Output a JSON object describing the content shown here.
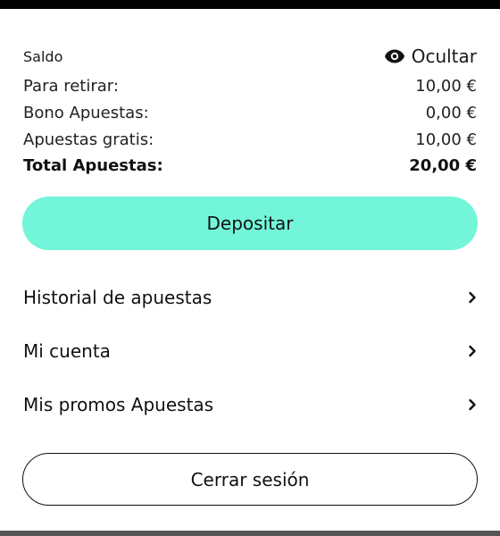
{
  "balance": {
    "label": "Saldo",
    "toggle_label": "Ocultar",
    "rows": [
      {
        "label": "Para retirar:",
        "value": "10,00 €"
      },
      {
        "label": "Bono Apuestas:",
        "value": "0,00 €"
      },
      {
        "label": "Apuestas gratis:",
        "value": "10,00 €"
      }
    ],
    "total": {
      "label": "Total Apuestas:",
      "value": "20,00 €"
    }
  },
  "deposit_label": "Depositar",
  "menu": [
    {
      "label": "Historial de apuestas",
      "icon": "chevron-right-icon"
    },
    {
      "label": "Mi cuenta",
      "icon": "chevron-right-icon"
    },
    {
      "label": "Mis promos Apuestas",
      "icon": "chevron-right-icon"
    }
  ],
  "logout_label": "Cerrar sesión",
  "colors": {
    "accent": "#72f5d8",
    "text": "#111111",
    "background": "#ffffff"
  }
}
